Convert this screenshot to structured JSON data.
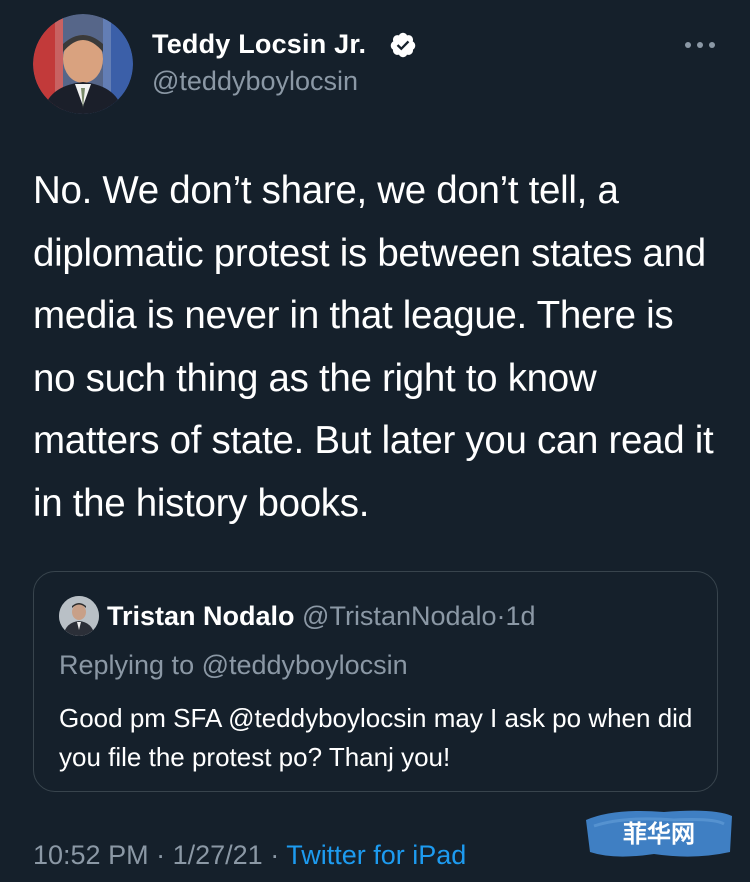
{
  "tweet": {
    "author": {
      "name": "Teddy Locsin Jr.",
      "handle": "@teddyboylocsin",
      "verified": true
    },
    "text": "No. We don’t share, we don’t tell, a diplomatic protest is between states and media is never in that league. There is no such thing as the right to know matters of state. But later you can read it in the history books.",
    "icons": [
      "verified-badge-icon",
      "more-options-icon"
    ]
  },
  "quoted_tweet": {
    "name": "Tristan Nodalo",
    "handle": "@TristanNodalo",
    "separator": "·",
    "age": "1d",
    "replying_to": "Replying to @teddyboylocsin",
    "text": "Good pm SFA @teddyboylocsin may I ask po when did you file the protest po? Thanj you!"
  },
  "footer": {
    "time": "10:52 PM",
    "separator": "·",
    "date": "1/27/21",
    "source": "Twitter for iPad"
  },
  "watermark": {
    "text": "菲华网"
  },
  "colors": {
    "background": "#15202b",
    "text": "#ffffff",
    "secondary": "#8b98a5",
    "accent": "#1d9bf0",
    "border": "#38444d"
  }
}
